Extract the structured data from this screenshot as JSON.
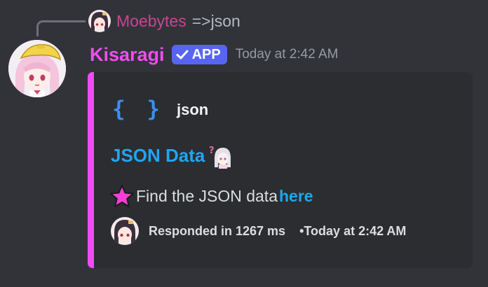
{
  "reply": {
    "username": "Moebytes",
    "text": "=>json",
    "username_color": "#c94593"
  },
  "message": {
    "username": "Kisaragi",
    "username_color": "#f24cf0",
    "badge": "APP",
    "badge_icon": "checkmark-icon",
    "timestamp": "Today at 2:42 AM"
  },
  "embed": {
    "accent_color": "#f24cf0",
    "author_icon": "curly-braces-icon",
    "author_braces": "{ }",
    "author_name": "json",
    "title": "JSON Data",
    "title_emoji": "anime-girl-question-emoji",
    "description_icon": "pink-star-emoji",
    "description_text": "Find the JSON data ",
    "description_link": "here",
    "footer": {
      "response_time": "Responded in 1267 ms",
      "separator": "•",
      "timestamp": "Today at 2:42 AM"
    }
  }
}
